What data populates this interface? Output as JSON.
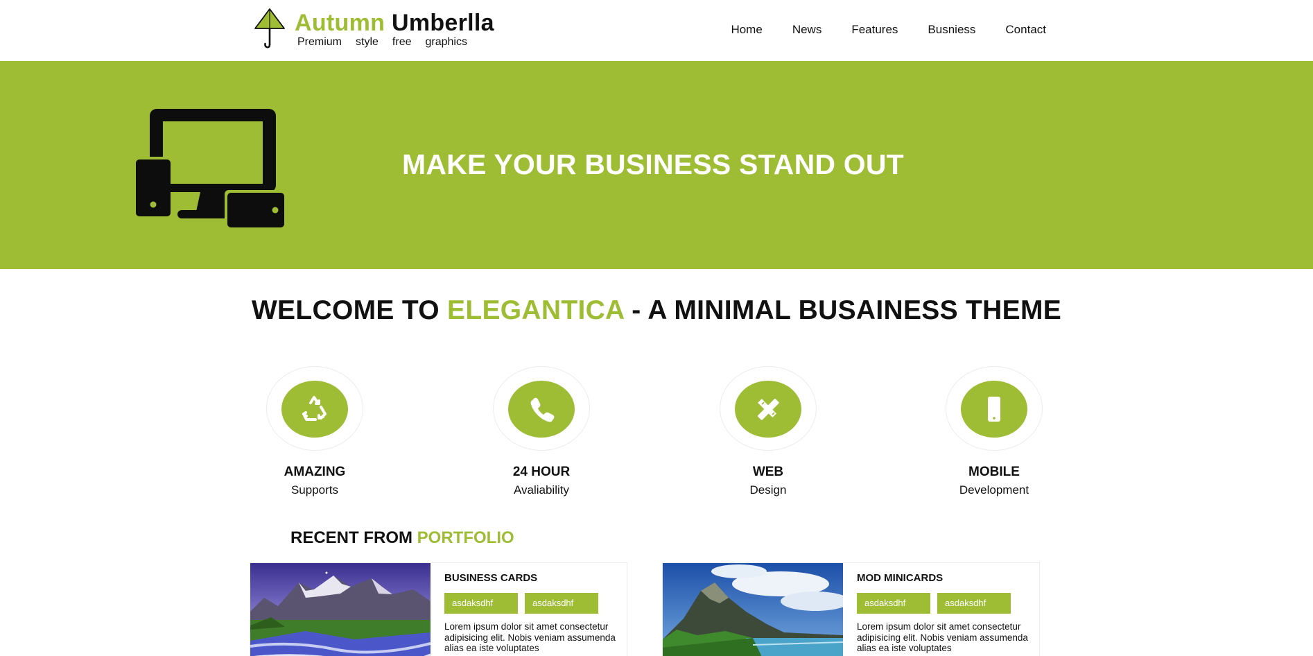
{
  "brand": {
    "name_accent": "Autumn",
    "name_dark": "Umberlla",
    "tagline": [
      "Premium",
      "style",
      "free",
      "graphics"
    ],
    "icon": "umbrella-icon"
  },
  "nav": {
    "items": [
      {
        "label": "Home"
      },
      {
        "label": "News"
      },
      {
        "label": "Features"
      },
      {
        "label": "Busniess"
      },
      {
        "label": "Contact"
      }
    ]
  },
  "hero": {
    "title": "MAKE YOUR BUSINESS STAND OUT",
    "icon": "responsive-devices-icon"
  },
  "welcome": {
    "prefix": "WELCOME TO ",
    "accent": "ELEGANTICA",
    "suffix": " - A MINIMAL BUSAINESS THEME"
  },
  "features": [
    {
      "title": "AMAZING",
      "subtitle": "Supports",
      "icon": "recycle-icon"
    },
    {
      "title": "24 HOUR",
      "subtitle": "Avaliability",
      "icon": "phone-icon"
    },
    {
      "title": "WEB",
      "subtitle": "Design",
      "icon": "pencil-ruler-icon"
    },
    {
      "title": "MOBILE",
      "subtitle": "Development",
      "icon": "mobile-icon"
    }
  ],
  "portfolio": {
    "heading_prefix": "RECENT FROM ",
    "heading_accent": "PORTFOLIO",
    "cards": [
      {
        "title": "BUSINESS CARDS",
        "tags": [
          "asdaksdhf",
          "asdaksdhf"
        ],
        "body": "Lorem ipsum dolor sit amet consectetur adipisicing elit. Nobis veniam assumenda alias ea iste voluptates",
        "image": "mountain-river-photo"
      },
      {
        "title": "MOD MINICARDS",
        "tags": [
          "asdaksdhf",
          "asdaksdhf"
        ],
        "body": "Lorem ipsum dolor sit amet consectetur adipisicing elit. Nobis veniam assumenda alias ea iste voluptates",
        "image": "mountain-lake-photo"
      }
    ]
  },
  "colors": {
    "accent": "#9ebd35",
    "text": "#111111",
    "background": "#ffffff"
  }
}
